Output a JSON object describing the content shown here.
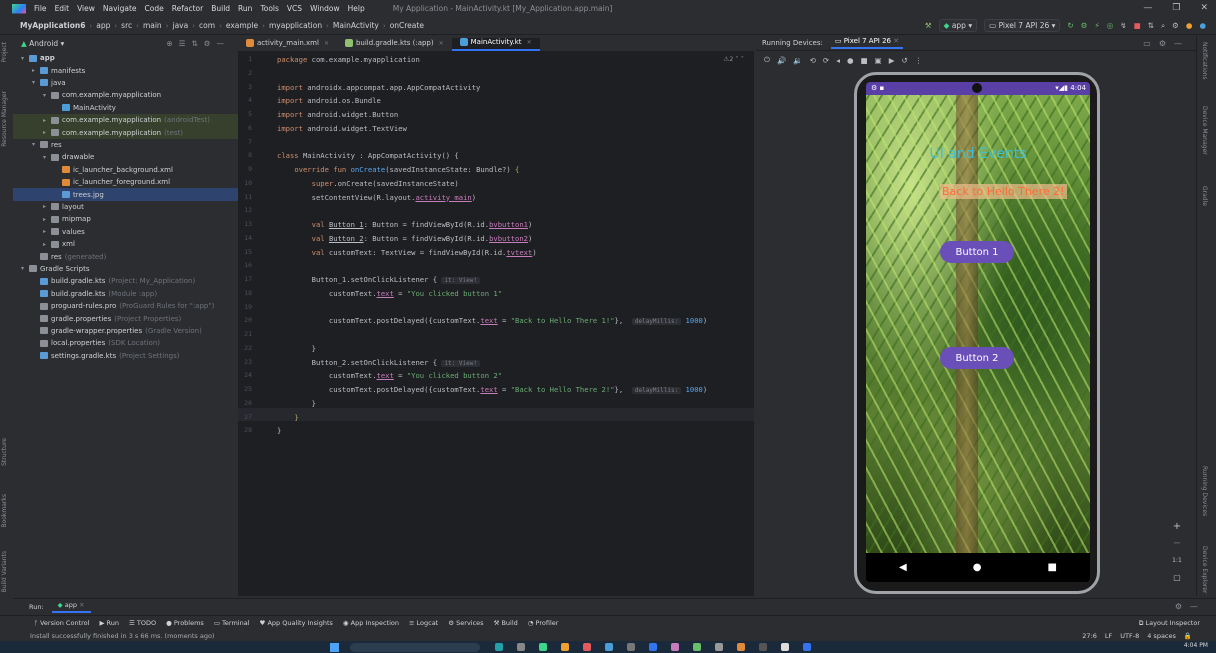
{
  "menu": {
    "items": [
      "File",
      "Edit",
      "View",
      "Navigate",
      "Code",
      "Refactor",
      "Build",
      "Run",
      "Tools",
      "VCS",
      "Window",
      "Help"
    ],
    "title": "My Application - MainActivity.kt [My_Application.app.main]"
  },
  "breadcrumbs": [
    "MyApplication6",
    "app",
    "src",
    "main",
    "java",
    "com",
    "example",
    "myapplication",
    "MainActivity",
    "onCreate"
  ],
  "toolbar": {
    "run_config": "app",
    "device": "Pixel 7 API 26"
  },
  "project": {
    "view": "Android",
    "tree": [
      {
        "label": "app",
        "indent": 0,
        "arrow": "▾",
        "color": "#5b9bd5",
        "bold": true
      },
      {
        "label": "manifests",
        "indent": 1,
        "arrow": "▸",
        "color": "#5b9bd5"
      },
      {
        "label": "java",
        "indent": 1,
        "arrow": "▾",
        "color": "#5b9bd5"
      },
      {
        "label": "com.example.myapplication",
        "indent": 2,
        "arrow": "▾",
        "color": "#8c8f96"
      },
      {
        "label": "MainActivity",
        "indent": 3,
        "arrow": "",
        "color": "#4c9ed9"
      },
      {
        "label": "com.example.myapplication",
        "sub": "(androidTest)",
        "indent": 2,
        "arrow": "▸",
        "color": "#8c8f96",
        "hl": true
      },
      {
        "label": "com.example.myapplication",
        "sub": "(test)",
        "indent": 2,
        "arrow": "▸",
        "color": "#8c8f96",
        "hl": true
      },
      {
        "label": "res",
        "indent": 1,
        "arrow": "▾",
        "color": "#8c8f96"
      },
      {
        "label": "drawable",
        "indent": 2,
        "arrow": "▾",
        "color": "#8c8f96"
      },
      {
        "label": "ic_launcher_background.xml",
        "indent": 3,
        "arrow": "",
        "color": "#e08a3c"
      },
      {
        "label": "ic_launcher_foreground.xml",
        "indent": 3,
        "arrow": "",
        "color": "#e08a3c"
      },
      {
        "label": "trees.jpg",
        "indent": 3,
        "arrow": "",
        "color": "#5b9bd5",
        "sel": true
      },
      {
        "label": "layout",
        "indent": 2,
        "arrow": "▸",
        "color": "#8c8f96"
      },
      {
        "label": "mipmap",
        "indent": 2,
        "arrow": "▸",
        "color": "#8c8f96"
      },
      {
        "label": "values",
        "indent": 2,
        "arrow": "▸",
        "color": "#8c8f96"
      },
      {
        "label": "xml",
        "indent": 2,
        "arrow": "▸",
        "color": "#8c8f96"
      },
      {
        "label": "res",
        "sub": "(generated)",
        "indent": 1,
        "arrow": "",
        "color": "#8c8f96"
      },
      {
        "label": "Gradle Scripts",
        "indent": 0,
        "arrow": "▾",
        "color": "#8c8f96"
      },
      {
        "label": "build.gradle.kts",
        "sub": "(Project: My_Application)",
        "indent": 1,
        "arrow": "",
        "color": "#5b9bd5"
      },
      {
        "label": "build.gradle.kts",
        "sub": "(Module :app)",
        "indent": 1,
        "arrow": "",
        "color": "#5b9bd5"
      },
      {
        "label": "proguard-rules.pro",
        "sub": "(ProGuard Rules for \":app\")",
        "indent": 1,
        "arrow": "",
        "color": "#8c8f96"
      },
      {
        "label": "gradle.properties",
        "sub": "(Project Properties)",
        "indent": 1,
        "arrow": "",
        "color": "#8c8f96"
      },
      {
        "label": "gradle-wrapper.properties",
        "sub": "(Gradle Version)",
        "indent": 1,
        "arrow": "",
        "color": "#8c8f96"
      },
      {
        "label": "local.properties",
        "sub": "(SDK Location)",
        "indent": 1,
        "arrow": "",
        "color": "#8c8f96"
      },
      {
        "label": "settings.gradle.kts",
        "sub": "(Project Settings)",
        "indent": 1,
        "arrow": "",
        "color": "#5b9bd5"
      }
    ]
  },
  "tabs": [
    {
      "label": "activity_main.xml",
      "active": false
    },
    {
      "label": "build.gradle.kts (:app)",
      "active": false
    },
    {
      "label": "MainActivity.kt",
      "active": true
    }
  ],
  "editor": {
    "inspection": "⚠2  ˄  ˅",
    "lines": [
      "<span class=\"kw\">package</span> com.example.myapplication",
      "",
      "<span class=\"kw\">import</span> androidx.appcompat.app.AppCompatActivity",
      "<span class=\"kw\">import</span> android.os.Bundle",
      "<span class=\"kw\">import</span> android.widget.Button",
      "<span class=\"kw\">import</span> android.widget.TextView",
      "",
      "<span class=\"kw\">class</span> MainActivity : AppCompatActivity() {",
      "    <span class=\"kw\">override fun</span> <span class=\"fn\">onCreate</span>(savedInstanceState: Bundle?) <span class=\"ann\">{</span>",
      "        <span class=\"kw\">super</span>.onCreate(savedInstanceState)",
      "        setContentView(R.layout.<span class=\"pr ul\">activity_main</span>)",
      "",
      "        <span class=\"kw\">val</span> <span class=\"ul\">Button_1</span>: Button = findViewById(R.id.<span class=\"pr ul\">bvbutton1</span>)",
      "        <span class=\"kw\">val</span> <span class=\"ul\">Button_2</span>: Button = findViewById(R.id.<span class=\"pr ul\">bvbutton2</span>)",
      "        <span class=\"kw\">val</span> customText: TextView = findViewById(R.id.<span class=\"pr ul\">tvtext</span>)",
      "",
      "        Button_1.setOnClickListener { <span class=\"hint\">it: View!</span>",
      "            customText.<span class=\"pr ul\">text</span> = <span class=\"str\">\"You clicked button 1\"</span>",
      "",
      "            customText.postDelayed({customText.<span class=\"pr ul\">text</span> = <span class=\"str\">\"Back to Hello There 1!\"</span>},  <span class=\"hint\">delayMillis:</span> <span class=\"fn\">1000</span>)",
      "",
      "        }",
      "        Button_2.setOnClickListener { <span class=\"hint\">it: View!</span>",
      "            customText.<span class=\"pr ul\">text</span> = <span class=\"str\">\"You clicked button 2\"</span>",
      "            customText.postDelayed({customText.<span class=\"pr ul\">text</span> = <span class=\"str\">\"Back to Hello There 2!\"</span>},  <span class=\"hint\">delayMillis:</span> <span class=\"fn\">1000</span>)",
      "        }",
      "    <span class=\"ann\">}</span>",
      "}"
    ]
  },
  "running_devices": {
    "label": "Running Devices:",
    "device_tab": "Pixel 7 API 26"
  },
  "phone": {
    "time": "4:04",
    "title": "UI and Events",
    "text": "Back to Hello There 2!",
    "button1": "Button 1",
    "button2": "Button 2"
  },
  "zoom": {
    "plus": "+",
    "minus": "−",
    "ratio": "1:1"
  },
  "right_tools": [
    "Notifications",
    "Device Manager",
    "Gradle",
    "Running Devices",
    "Device Explorer"
  ],
  "left_tools": [
    "Project",
    "Resource Manager",
    "Structure",
    "Bookmarks",
    "Build Variants"
  ],
  "run": {
    "label": "Run:",
    "config": "app"
  },
  "bottom_tools": [
    "Version Control",
    "Run",
    "TODO",
    "Problems",
    "Terminal",
    "App Quality Insights",
    "App Inspection",
    "Logcat",
    "Services",
    "Build",
    "Profiler"
  ],
  "layout_inspector": "Layout Inspector",
  "status": {
    "message": "Install successfully finished in 3 s 66 ms. (moments ago)",
    "position": "27:6",
    "line_sep": "LF",
    "encoding": "UTF-8",
    "indent": "4 spaces"
  },
  "clock": "4:04 PM",
  "colors": {
    "accent": "#3574f0",
    "phone_purple": "#6a4fb8",
    "title_cyan": "#3ec0d6"
  }
}
